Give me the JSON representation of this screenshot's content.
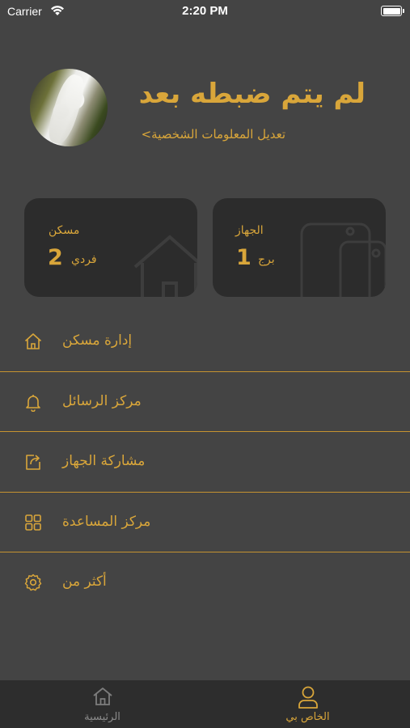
{
  "status_bar": {
    "carrier": "Carrier",
    "time": "2:20 PM"
  },
  "profile": {
    "name": "لم يتم ضبطه بعد",
    "edit_link": "تعديل المعلومات الشخصية>"
  },
  "cards": {
    "home": {
      "label": "مسكن",
      "count": "2",
      "unit": "فردي",
      "icon": "house-icon"
    },
    "device": {
      "label": "الجهاز",
      "count": "1",
      "unit": "برج",
      "icon": "phone-device-icon"
    }
  },
  "menu": [
    {
      "label": "إدارة مسكن",
      "icon": "home-icon"
    },
    {
      "label": "مركز الرسائل",
      "icon": "bell-icon"
    },
    {
      "label": "مشاركة الجهاز",
      "icon": "share-icon"
    },
    {
      "label": "مركز المساعدة",
      "icon": "grid-icon"
    },
    {
      "label": "أكثر من",
      "icon": "gear-icon"
    }
  ],
  "tabbar": {
    "home": "الرئيسية",
    "me": "الخاص بي"
  },
  "colors": {
    "accent": "#d9a63a",
    "background": "#444444",
    "card": "#2c2c2c",
    "tabbar": "#2d2d2d"
  }
}
